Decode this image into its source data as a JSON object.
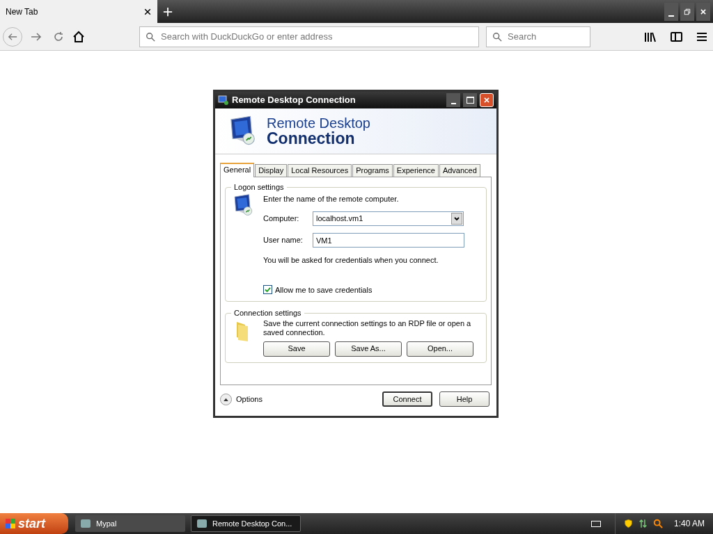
{
  "browser": {
    "tabs": [
      {
        "title": "New Tab",
        "selected": true
      }
    ],
    "address": {
      "placeholder": "Search with DuckDuckGo or enter address"
    },
    "search": {
      "placeholder": "Search"
    }
  },
  "dialog": {
    "title": "Remote Desktop Connection",
    "banner": {
      "line_1": "Remote Desktop",
      "line_2": "Connection"
    },
    "tabs": [
      {
        "label": "General",
        "selected": true
      },
      {
        "label": "Display",
        "selected": false
      },
      {
        "label": "Local Resources",
        "selected": false
      },
      {
        "label": "Programs",
        "selected": false
      },
      {
        "label": "Experience",
        "selected": false
      },
      {
        "label": "Advanced",
        "selected": false
      }
    ],
    "logon": {
      "legend": "Logon settings",
      "intro": "Enter the name of the remote computer.",
      "computer_label": "Computer:",
      "computer_value": "localhost.vm1",
      "user_label": "User name:",
      "user_value": "VM1",
      "note": "You will be asked for credentials when you connect.",
      "save_credentials": {
        "label": "Allow me to save credentials",
        "checked": true
      }
    },
    "connection": {
      "legend": "Connection settings",
      "text": "Save the current connection settings to an RDP file or open a saved connection.",
      "buttons": [
        "Save",
        "Save As...",
        "Open..."
      ]
    },
    "options": "Options",
    "buttons": [
      {
        "label": "Connect",
        "default": true
      },
      {
        "label": "Help",
        "default": false
      }
    ]
  },
  "taskbar": {
    "start": "start",
    "items": [
      {
        "label": "Mypal",
        "selected": false
      },
      {
        "label": "Remote Desktop Con...",
        "selected": true
      }
    ],
    "clock": "1:40 AM"
  }
}
